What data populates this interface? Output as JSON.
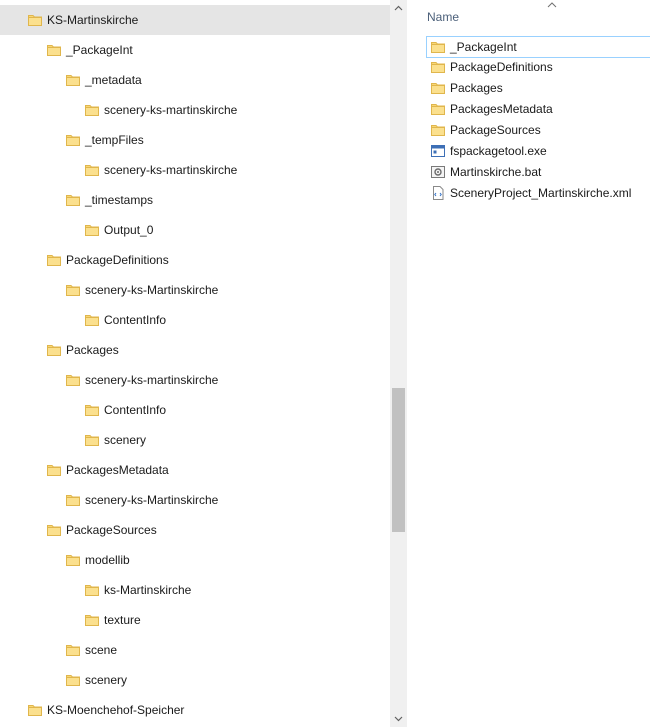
{
  "tree": {
    "items": [
      {
        "label": "KS-Martinskirche",
        "level": 0,
        "selected": true
      },
      {
        "label": "_PackageInt",
        "level": 1
      },
      {
        "label": "_metadata",
        "level": 2
      },
      {
        "label": "scenery-ks-martinskirche",
        "level": 3
      },
      {
        "label": "_tempFiles",
        "level": 2
      },
      {
        "label": "scenery-ks-martinskirche",
        "level": 3
      },
      {
        "label": "_timestamps",
        "level": 2
      },
      {
        "label": "Output_0",
        "level": 3
      },
      {
        "label": "PackageDefinitions",
        "level": 1
      },
      {
        "label": "scenery-ks-Martinskirche",
        "level": 2
      },
      {
        "label": "ContentInfo",
        "level": 3
      },
      {
        "label": "Packages",
        "level": 1
      },
      {
        "label": "scenery-ks-martinskirche",
        "level": 2
      },
      {
        "label": "ContentInfo",
        "level": 3
      },
      {
        "label": "scenery",
        "level": 3
      },
      {
        "label": "PackagesMetadata",
        "level": 1
      },
      {
        "label": "scenery-ks-Martinskirche",
        "level": 2
      },
      {
        "label": "PackageSources",
        "level": 1
      },
      {
        "label": "modellib",
        "level": 2
      },
      {
        "label": "ks-Martinskirche",
        "level": 3
      },
      {
        "label": "texture",
        "level": 3
      },
      {
        "label": "scene",
        "level": 2
      },
      {
        "label": "scenery",
        "level": 2
      },
      {
        "label": "KS-Moenchehof-Speicher",
        "level": 0
      }
    ]
  },
  "list": {
    "column_name": "Name",
    "items": [
      {
        "label": "_PackageInt",
        "icon": "folder-icon",
        "selected": true
      },
      {
        "label": "PackageDefinitions",
        "icon": "folder-icon"
      },
      {
        "label": "Packages",
        "icon": "folder-icon"
      },
      {
        "label": "PackagesMetadata",
        "icon": "folder-icon"
      },
      {
        "label": "PackageSources",
        "icon": "folder-icon"
      },
      {
        "label": "fspackagetool.exe",
        "icon": "exe-icon"
      },
      {
        "label": "Martinskirche.bat",
        "icon": "bat-icon"
      },
      {
        "label": "SceneryProject_Martinskirche.xml",
        "icon": "xml-icon"
      }
    ]
  },
  "colors": {
    "folder": "#f8d775",
    "selection_tree": "#e5e5e5",
    "selection_list": "#99d1ff",
    "header_text": "#4c607a"
  }
}
